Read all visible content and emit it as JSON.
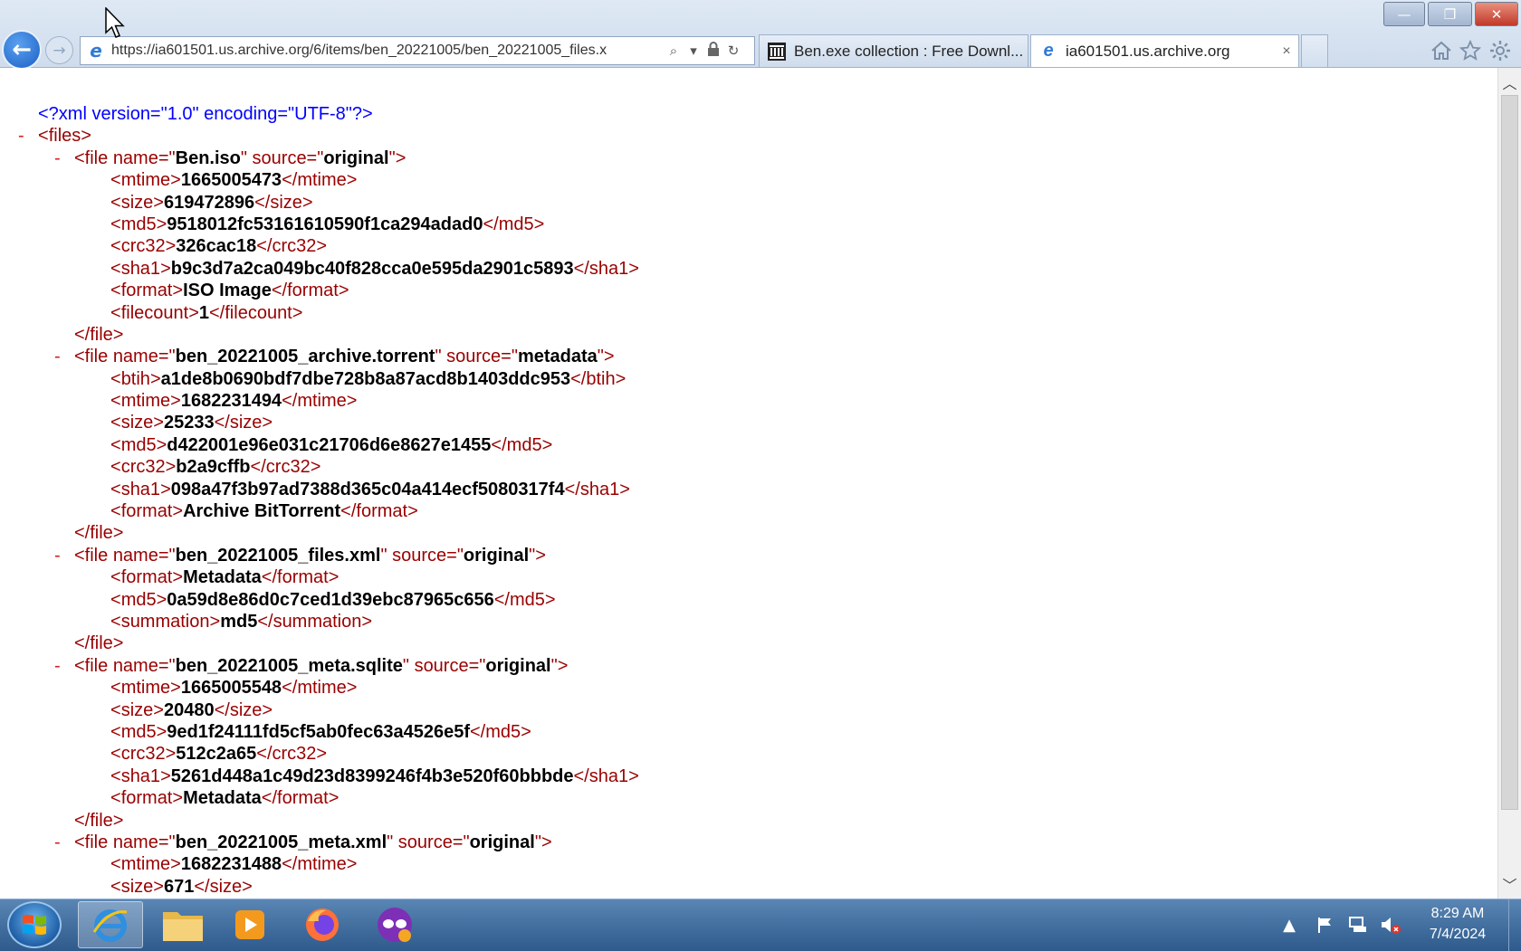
{
  "window": {
    "minimize_glyph": "—",
    "maximize_glyph": "❐",
    "close_glyph": "✕"
  },
  "toolbar": {
    "back_glyph": "←",
    "forward_glyph": "→",
    "address_url": "https://ia601501.us.archive.org/6/items/ben_20221005/ben_20221005_files.x",
    "search_glyph": "⌕",
    "dropdown_glyph": "▾",
    "lock_glyph": "🔒",
    "refresh_glyph": "↻",
    "home_icon": "home-icon",
    "favorites_icon": "star-icon",
    "tools_icon": "gear-icon"
  },
  "tabs": [
    {
      "label": "Ben.exe collection : Free Downl...",
      "icon": "archive-icon",
      "active": false
    },
    {
      "label": "ia601501.us.archive.org",
      "icon": "ie-icon",
      "active": true,
      "close": "×"
    }
  ],
  "xml": {
    "declaration": "<?xml version=\"1.0\" encoding=\"UTF-8\"?>",
    "root": "files",
    "files": [
      {
        "name": "Ben.iso",
        "source": "original",
        "fields": [
          {
            "tag": "mtime",
            "value": "1665005473"
          },
          {
            "tag": "size",
            "value": "619472896"
          },
          {
            "tag": "md5",
            "value": "9518012fc53161610590f1ca294adad0"
          },
          {
            "tag": "crc32",
            "value": "326cac18"
          },
          {
            "tag": "sha1",
            "value": "b9c3d7a2ca049bc40f828cca0e595da2901c5893"
          },
          {
            "tag": "format",
            "value": "ISO Image"
          },
          {
            "tag": "filecount",
            "value": "1"
          }
        ]
      },
      {
        "name": "ben_20221005_archive.torrent",
        "source": "metadata",
        "fields": [
          {
            "tag": "btih",
            "value": "a1de8b0690bdf7dbe728b8a87acd8b1403ddc953"
          },
          {
            "tag": "mtime",
            "value": "1682231494"
          },
          {
            "tag": "size",
            "value": "25233"
          },
          {
            "tag": "md5",
            "value": "d422001e96e031c21706d6e8627e1455"
          },
          {
            "tag": "crc32",
            "value": "b2a9cffb"
          },
          {
            "tag": "sha1",
            "value": "098a47f3b97ad7388d365c04a414ecf5080317f4"
          },
          {
            "tag": "format",
            "value": "Archive BitTorrent"
          }
        ]
      },
      {
        "name": "ben_20221005_files.xml",
        "source": "original",
        "fields": [
          {
            "tag": "format",
            "value": "Metadata"
          },
          {
            "tag": "md5",
            "value": "0a59d8e86d0c7ced1d39ebc87965c656"
          },
          {
            "tag": "summation",
            "value": "md5"
          }
        ]
      },
      {
        "name": "ben_20221005_meta.sqlite",
        "source": "original",
        "fields": [
          {
            "tag": "mtime",
            "value": "1665005548"
          },
          {
            "tag": "size",
            "value": "20480"
          },
          {
            "tag": "md5",
            "value": "9ed1f24111fd5cf5ab0fec63a4526e5f"
          },
          {
            "tag": "crc32",
            "value": "512c2a65"
          },
          {
            "tag": "sha1",
            "value": "5261d448a1c49d23d8399246f4b3e520f60bbbde"
          },
          {
            "tag": "format",
            "value": "Metadata"
          }
        ]
      },
      {
        "name": "ben_20221005_meta.xml",
        "source": "original",
        "fields": [
          {
            "tag": "mtime",
            "value": "1682231488"
          },
          {
            "tag": "size",
            "value": "671"
          }
        ],
        "truncated": true
      }
    ]
  },
  "taskbar": {
    "apps": [
      {
        "name": "internet-explorer",
        "active": true
      },
      {
        "name": "file-explorer",
        "active": false
      },
      {
        "name": "media-player",
        "active": false
      },
      {
        "name": "firefox",
        "active": false
      },
      {
        "name": "tor-browser",
        "active": false
      }
    ],
    "clock_time": "8:29 AM",
    "clock_date": "7/4/2024"
  },
  "colors": {
    "tag": "#990000",
    "attr_value": "#0000ff",
    "toggle": "#d21f1f",
    "accent": "#1c5fc4"
  }
}
